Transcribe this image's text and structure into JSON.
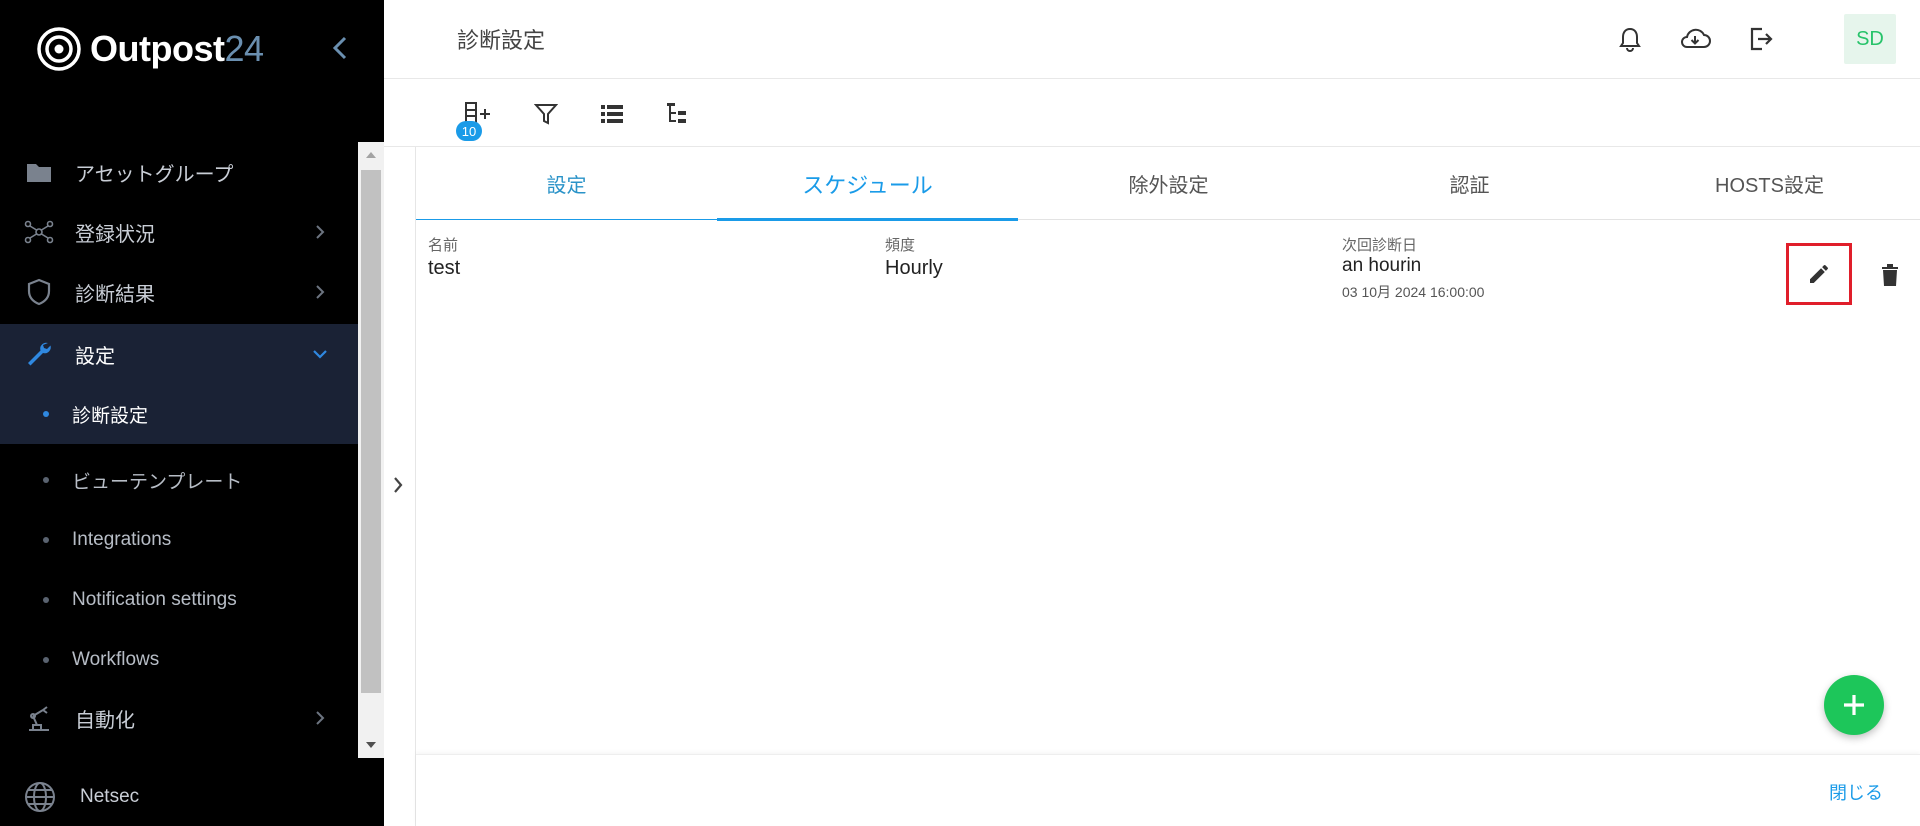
{
  "brand": {
    "name": "Outpost",
    "number": "24"
  },
  "sidebar": {
    "items": [
      {
        "label": "アセットグループ",
        "icon": "folder-icon"
      },
      {
        "label": "登録状況",
        "icon": "network-icon"
      },
      {
        "label": "診断結果",
        "icon": "shield-icon"
      },
      {
        "label": "設定",
        "icon": "wrench-icon"
      },
      {
        "label": "自動化",
        "icon": "robot-arm-icon"
      }
    ],
    "sub_items": [
      {
        "label": "診断設定",
        "active": true
      },
      {
        "label": "ビューテンプレート"
      },
      {
        "label": "Integrations"
      },
      {
        "label": "Notification settings"
      },
      {
        "label": "Workflows"
      }
    ],
    "footer": {
      "label": "Netsec",
      "icon": "globe-icon"
    }
  },
  "header": {
    "title": "診断設定",
    "avatar_initials": "SD"
  },
  "toolbar": {
    "badge_count": "10"
  },
  "tabs": [
    {
      "label": "設定"
    },
    {
      "label": "スケジュール",
      "active": true
    },
    {
      "label": "除外設定"
    },
    {
      "label": "認証"
    },
    {
      "label": "HOSTS設定"
    }
  ],
  "schedule": {
    "headers": {
      "name": "名前",
      "frequency": "頻度",
      "next_scan": "次回診断日"
    },
    "row": {
      "name": "test",
      "frequency": "Hourly",
      "next_scan_relative": "an hourin",
      "next_scan_date": "03 10月 2024 16:00:00"
    }
  },
  "footer": {
    "close_label": "閉じる"
  },
  "colors": {
    "accent": "#1a9be8",
    "fab": "#1dc65a",
    "highlight": "#e01e2a"
  }
}
